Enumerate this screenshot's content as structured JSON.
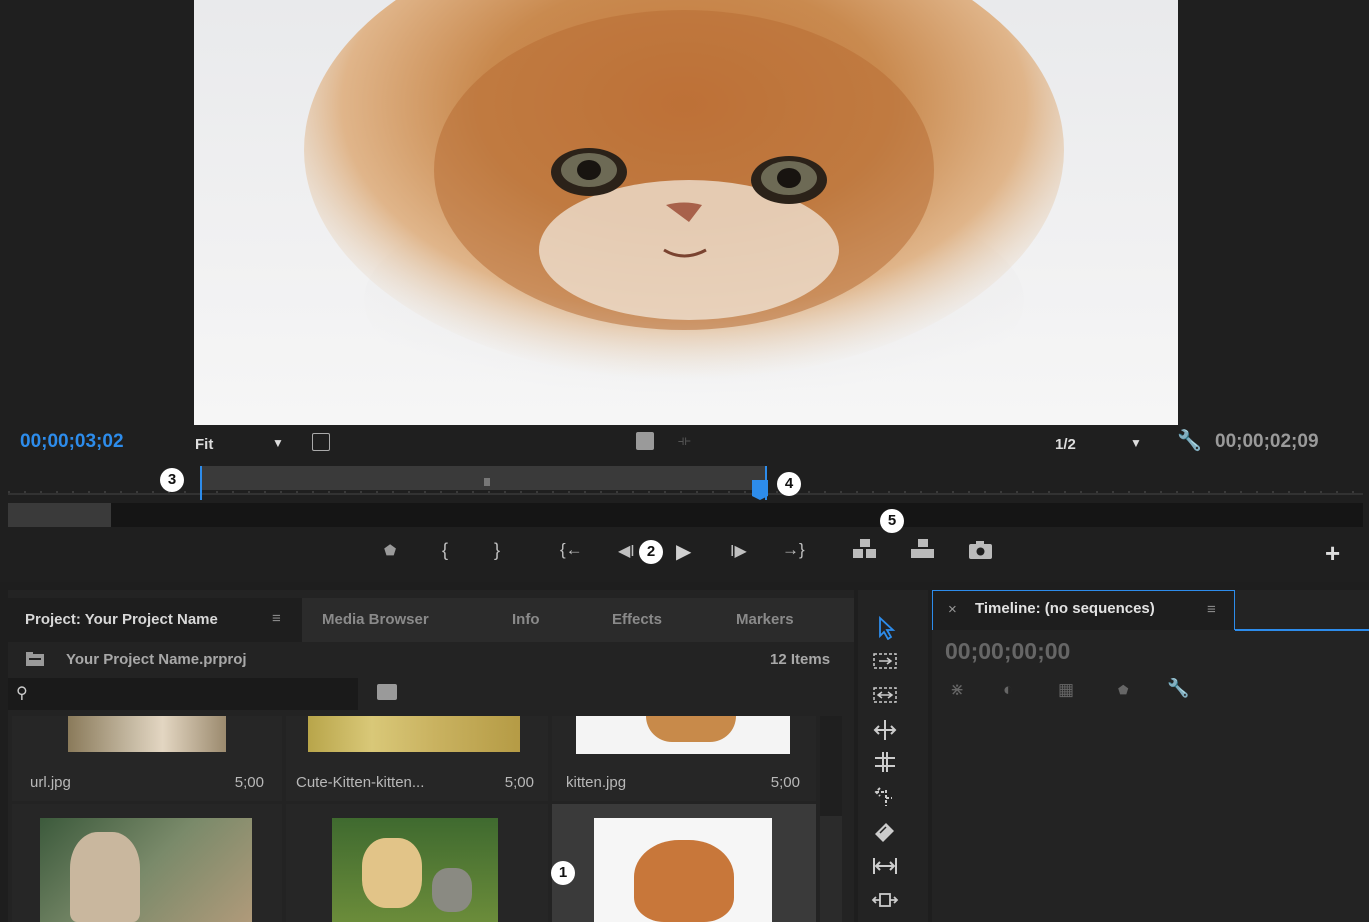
{
  "monitor": {
    "timecode_left": "00;00;03;02",
    "fit_label": "Fit",
    "resolution_label": "1/2",
    "timecode_right": "00;00;02;09"
  },
  "callouts": [
    "1",
    "2",
    "3",
    "4",
    "5"
  ],
  "panel_tabs": [
    {
      "label": "Project: Your Project Name",
      "active": true
    },
    {
      "label": "Media Browser",
      "active": false
    },
    {
      "label": "Info",
      "active": false
    },
    {
      "label": "Effects",
      "active": false
    },
    {
      "label": "Markers",
      "active": false
    }
  ],
  "project": {
    "file_name": "Your Project Name.prproj",
    "item_count": "12 Items",
    "search_value": "",
    "items": [
      {
        "name": "url.jpg",
        "duration": "5;00"
      },
      {
        "name": "Cute-Kitten-kitten...",
        "duration": "5;00"
      },
      {
        "name": "kitten.jpg",
        "duration": "5;00"
      }
    ]
  },
  "timeline": {
    "tab_label": "Timeline: (no sequences)",
    "close_glyph": "×",
    "timecode": "00;00;00;00"
  },
  "colors": {
    "accent_blue": "#2d8ceb",
    "panel_bg": "#232323",
    "tab_bar_bg": "#2b2b2b"
  },
  "icons": [
    "marker-icon",
    "mark-in-icon",
    "mark-out-icon",
    "go-to-in-icon",
    "step-back-icon",
    "play-icon",
    "step-forward-icon",
    "go-to-out-icon",
    "insert-icon",
    "overwrite-icon",
    "export-frame-icon",
    "add-button-icon",
    "wrench-icon",
    "settings-icon",
    "selection-tool-icon",
    "ripple-edit-tool-icon",
    "rolling-edit-tool-icon",
    "rate-stretch-tool-icon",
    "razor-tool-icon",
    "slip-tool-icon",
    "slide-tool-icon",
    "pen-tool-icon",
    "folder-icon",
    "search-icon",
    "new-bin-icon",
    "snap-icon",
    "linked-selection-icon",
    "add-marker-icon",
    "timeline-settings-icon"
  ]
}
